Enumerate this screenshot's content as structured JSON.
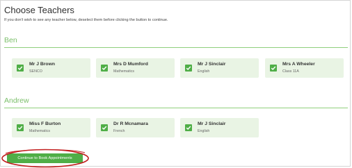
{
  "page": {
    "title": "Choose Teachers",
    "instructions": "If you don't wish to see any teacher below, deselect them before clicking the button to continue."
  },
  "groups": [
    {
      "name": "Ben",
      "teachers": [
        {
          "name": "Mr J Brown",
          "subject": "SENCO",
          "checked": true
        },
        {
          "name": "Mrs D Mumford",
          "subject": "Mathematics",
          "checked": true
        },
        {
          "name": "Mr J Sinclair",
          "subject": "English",
          "checked": true
        },
        {
          "name": "Mrs A Wheeler",
          "subject": "Class 11A",
          "checked": true
        }
      ]
    },
    {
      "name": "Andrew",
      "teachers": [
        {
          "name": "Miss F Burton",
          "subject": "Mathematics",
          "checked": true
        },
        {
          "name": "Dr R Mcnamara",
          "subject": "French",
          "checked": true
        },
        {
          "name": "Mr J Sinclair",
          "subject": "English",
          "checked": true
        }
      ]
    }
  ],
  "continue_button": {
    "label": "Continue to Book Appointments"
  },
  "colors": {
    "accent_green": "#4fae47",
    "card_background": "#e9f4e4",
    "group_heading": "#7bbf6a",
    "annotation_ellipse": "#c21e1e"
  }
}
